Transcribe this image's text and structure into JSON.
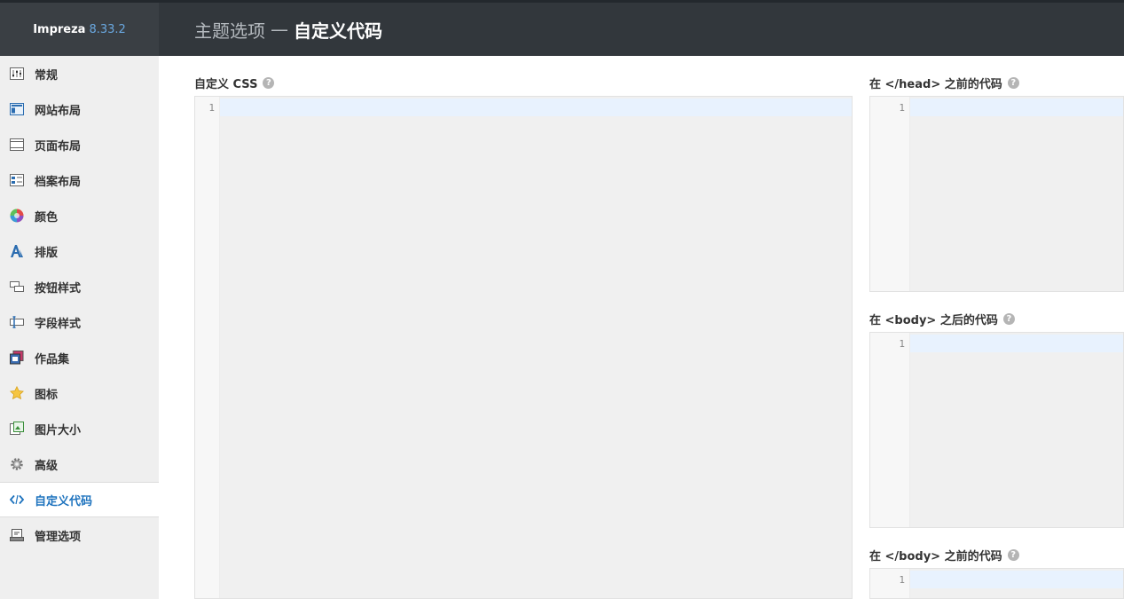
{
  "brand": {
    "name": "Impreza",
    "version": "8.33.2"
  },
  "header": {
    "section": "主题选项",
    "separator": "—",
    "current": "自定义代码"
  },
  "sidebar": {
    "items": [
      {
        "label": "常规",
        "icon": "general-icon"
      },
      {
        "label": "网站布局",
        "icon": "site-layout-icon"
      },
      {
        "label": "页面布局",
        "icon": "page-layout-icon"
      },
      {
        "label": "档案布局",
        "icon": "archive-layout-icon"
      },
      {
        "label": "颜色",
        "icon": "color-icon"
      },
      {
        "label": "排版",
        "icon": "typography-icon"
      },
      {
        "label": "按钮样式",
        "icon": "button-style-icon"
      },
      {
        "label": "字段样式",
        "icon": "field-style-icon"
      },
      {
        "label": "作品集",
        "icon": "portfolio-icon"
      },
      {
        "label": "图标",
        "icon": "star-icon"
      },
      {
        "label": "图片大小",
        "icon": "image-size-icon"
      },
      {
        "label": "高级",
        "icon": "gear-icon"
      },
      {
        "label": "自定义代码",
        "icon": "code-icon",
        "active": true
      },
      {
        "label": "管理选项",
        "icon": "manage-options-icon"
      }
    ]
  },
  "fields": {
    "custom_css": {
      "label": "自定义 CSS",
      "line": "1"
    },
    "before_head": {
      "label": "在 </head> 之前的代码",
      "line": "1"
    },
    "after_body": {
      "label": "在 <body> 之后的代码",
      "line": "1"
    },
    "before_body": {
      "label": "在 </body> 之前的代码",
      "line": "1"
    }
  },
  "colors": {
    "accent": "#1e73be",
    "header_bg": "#32373c",
    "sidebar_bg": "#efefef"
  }
}
